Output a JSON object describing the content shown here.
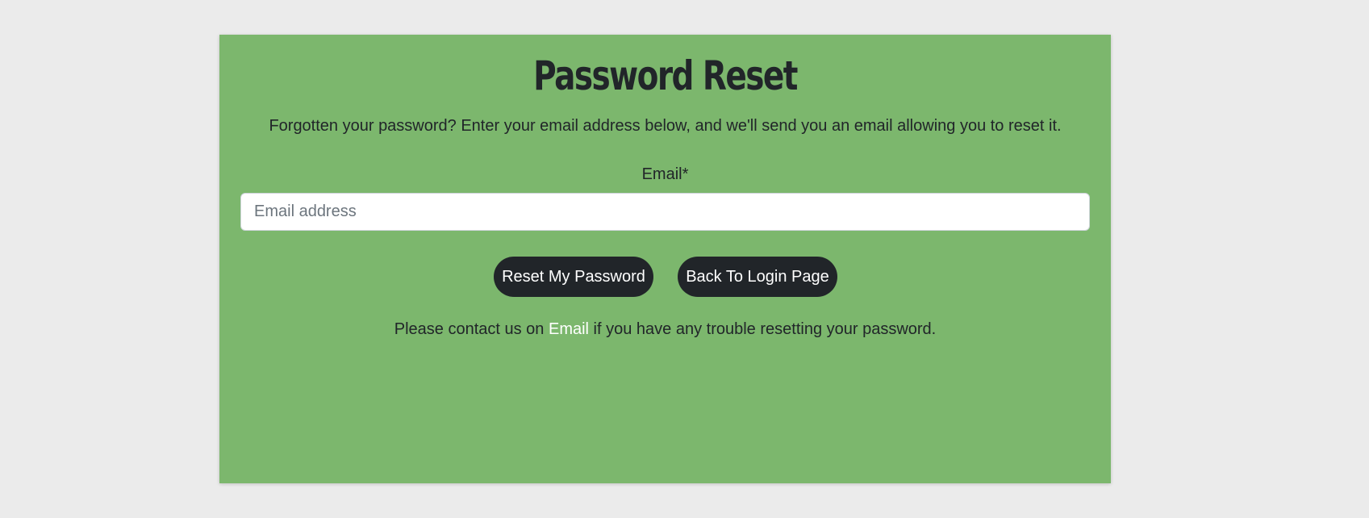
{
  "page": {
    "title": "Password Reset",
    "subtitle": "Forgotten your password? Enter your email address below, and we'll send you an email allowing you to reset it."
  },
  "form": {
    "email_label": "Email*",
    "email_placeholder": "Email address",
    "email_value": ""
  },
  "buttons": {
    "reset_label": "Reset My Password",
    "back_label": "Back To Login Page"
  },
  "contact": {
    "before": "Please contact us on ",
    "link_text": "Email",
    "after": " if you have any trouble resetting your password."
  },
  "colors": {
    "background": "#ebebeb",
    "card": "#7cb76d",
    "button": "#212529",
    "link": "#ffffff"
  }
}
